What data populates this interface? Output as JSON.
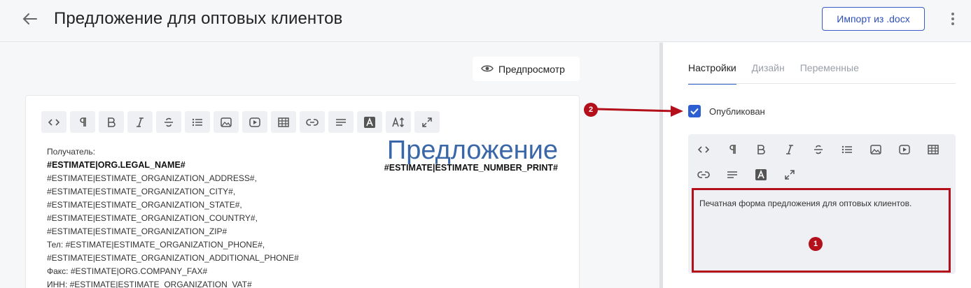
{
  "header": {
    "title": "Предложение для оптовых клиентов",
    "import_label": "Импорт из .docx",
    "back_icon": "arrow-left-icon",
    "menu_icon": "kebab-menu-icon"
  },
  "preview": {
    "label": "Предпросмотр",
    "icon": "eye-icon"
  },
  "toolbar_main": [
    "code",
    "paragraph",
    "bold",
    "italic",
    "strikethrough",
    "list",
    "image",
    "video",
    "table",
    "link",
    "align",
    "font-color",
    "font-size",
    "fullscreen"
  ],
  "document": {
    "heading": "Предложение",
    "number_var": "#ESTIMATE|ESTIMATE_NUMBER_PRINT#",
    "lines": [
      "Получатель:",
      "#ESTIMATE|ORG.LEGAL_NAME#",
      "#ESTIMATE|ESTIMATE_ORGANIZATION_ADDRESS#,",
      "#ESTIMATE|ESTIMATE_ORGANIZATION_CITY#,",
      "#ESTIMATE|ESTIMATE_ORGANIZATION_STATE#,",
      "#ESTIMATE|ESTIMATE_ORGANIZATION_COUNTRY#,",
      "#ESTIMATE|ESTIMATE_ORGANIZATION_ZIP#",
      "Тел: #ESTIMATE|ESTIMATE_ORGANIZATION_PHONE#,",
      "#ESTIMATE|ESTIMATE_ORGANIZATION_ADDITIONAL_PHONE#",
      "Факс: #ESTIMATE|ORG.COMPANY_FAX#",
      "ИНН: #ESTIMATE|ESTIMATE_ORGANIZATION_VAT#"
    ]
  },
  "tabs": [
    {
      "label": "Настройки",
      "active": true
    },
    {
      "label": "Дизайн",
      "active": false
    },
    {
      "label": "Переменные",
      "active": false
    }
  ],
  "published": {
    "label": "Опубликован",
    "checked": true
  },
  "description": {
    "text": "Печатная форма предложения для оптовых клиентов."
  },
  "annotations": {
    "marker1": "1",
    "marker2": "2",
    "color": "#b3101b"
  },
  "colors": {
    "accent": "#2c5fd1",
    "heading_blue": "#3a67a8"
  }
}
